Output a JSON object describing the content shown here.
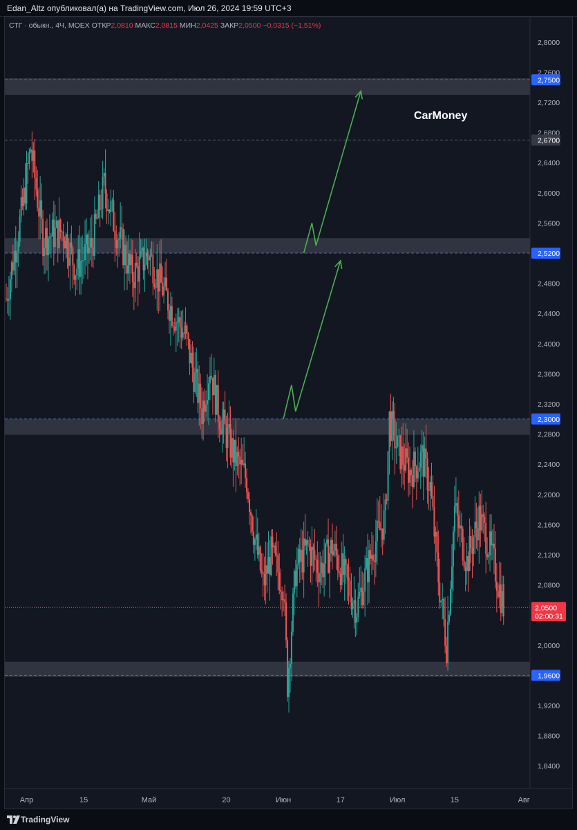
{
  "header": {
    "publisher_line": "Edan_Altz опубликовал(а) на TradingView.com, Июл 26, 2024 19:59 UTC+3"
  },
  "legend": {
    "symbol": "СТГ · обыкн., 4Ч, MOEX",
    "open_label": "ОТКР",
    "open_value": "2,0810",
    "high_label": "МАКС",
    "high_value": "2,0815",
    "low_label": "МИН",
    "low_value": "2,0425",
    "close_label": "ЗАКР",
    "close_value": "2,0500",
    "change": "−0,0315 (−1,51%)"
  },
  "brand_watermark": "CarMoney",
  "footer": {
    "logo_text": "TradingView",
    "logo_icon": "tradingview-logo-icon"
  },
  "colors": {
    "up": "#26a69a",
    "down": "#ef5350",
    "background": "#131722",
    "zone": "#3b3f4b",
    "arrow": "#4caf50",
    "axis_text": "#b2b5be",
    "level_badge": "#2962ff",
    "price_badge": "#f23645"
  },
  "chart_data": {
    "type": "candlestick",
    "title": "",
    "xlabel": "",
    "ylabel": "",
    "ylim": [
      1.82,
      2.82
    ],
    "grid": false,
    "y_ticks": [
      "2,8000",
      "2,7600",
      "2,7200",
      "2,6800",
      "2,6400",
      "2,6000",
      "2,5600",
      "2,4800",
      "2,4400",
      "2,4000",
      "2,3600",
      "2,3200",
      "2,2800",
      "2,2400",
      "2,2000",
      "2,1600",
      "2,1200",
      "2,0800",
      "2,0000",
      "1,9200",
      "1,8800",
      "1,8400"
    ],
    "x_ticks": [
      {
        "label": "Апр",
        "date": "2024-04-01"
      },
      {
        "label": "15",
        "date": "2024-04-15"
      },
      {
        "label": "Май",
        "date": "2024-05-01"
      },
      {
        "label": "20",
        "date": "2024-05-20"
      },
      {
        "label": "Июн",
        "date": "2024-06-03"
      },
      {
        "label": "17",
        "date": "2024-06-17"
      },
      {
        "label": "Июл",
        "date": "2024-07-01"
      },
      {
        "label": "15",
        "date": "2024-07-15"
      },
      {
        "label": "Авг",
        "date": "2024-08-01"
      }
    ],
    "price_levels": [
      {
        "label": "2,7500",
        "value": 2.75,
        "style": "dashed-blue"
      },
      {
        "label": "2,6700",
        "value": 2.67,
        "style": "dashed-gray"
      },
      {
        "label": "2,5200",
        "value": 2.52,
        "style": "dashed-blue"
      },
      {
        "label": "2,3000",
        "value": 2.3,
        "style": "dashed-blue"
      },
      {
        "label": "1,9600",
        "value": 1.96,
        "style": "dashed-blue"
      }
    ],
    "current_price": {
      "label": "2,0500",
      "countdown": "02:00:31",
      "value": 2.05
    },
    "zones": [
      {
        "from": 2.73,
        "to": 2.752
      },
      {
        "from": 2.52,
        "to": 2.54
      },
      {
        "from": 2.279,
        "to": 2.3
      },
      {
        "from": 1.958,
        "to": 1.978
      }
    ],
    "arrows": [
      {
        "points": [
          [
            "2024-06-03",
            2.3
          ],
          [
            "2024-06-05",
            2.345
          ],
          [
            "2024-06-06",
            2.31
          ],
          [
            "2024-06-17",
            2.51
          ]
        ]
      },
      {
        "points": [
          [
            "2024-06-08",
            2.52
          ],
          [
            "2024-06-10",
            2.56
          ],
          [
            "2024-06-11",
            2.53
          ],
          [
            "2024-06-22",
            2.735
          ]
        ]
      }
    ],
    "anchors": [
      [
        "2024-03-27",
        2.46
      ],
      [
        "2024-03-31",
        2.58
      ],
      [
        "2024-04-02",
        2.66
      ],
      [
        "2024-04-05",
        2.54
      ],
      [
        "2024-04-10",
        2.55
      ],
      [
        "2024-04-13",
        2.5
      ],
      [
        "2024-04-17",
        2.53
      ],
      [
        "2024-04-20",
        2.61
      ],
      [
        "2024-04-23",
        2.55
      ],
      [
        "2024-04-27",
        2.49
      ],
      [
        "2024-05-01",
        2.52
      ],
      [
        "2024-05-03",
        2.49
      ],
      [
        "2024-05-07",
        2.44
      ],
      [
        "2024-05-10",
        2.41
      ],
      [
        "2024-05-14",
        2.31
      ],
      [
        "2024-05-16",
        2.37
      ],
      [
        "2024-05-18",
        2.31
      ],
      [
        "2024-05-22",
        2.25
      ],
      [
        "2024-05-25",
        2.22
      ],
      [
        "2024-05-27",
        2.14
      ],
      [
        "2024-05-29",
        2.08
      ],
      [
        "2024-05-31",
        2.12
      ],
      [
        "2024-06-03",
        2.08
      ],
      [
        "2024-06-04",
        1.95
      ],
      [
        "2024-06-06",
        2.1
      ],
      [
        "2024-06-09",
        2.13
      ],
      [
        "2024-06-12",
        2.1
      ],
      [
        "2024-06-15",
        2.13
      ],
      [
        "2024-06-18",
        2.09
      ],
      [
        "2024-06-21",
        2.05
      ],
      [
        "2024-06-25",
        2.13
      ],
      [
        "2024-06-28",
        2.17
      ],
      [
        "2024-06-29",
        2.3
      ],
      [
        "2024-07-01",
        2.26
      ],
      [
        "2024-07-04",
        2.23
      ],
      [
        "2024-07-07",
        2.25
      ],
      [
        "2024-07-09",
        2.21
      ],
      [
        "2024-07-11",
        2.09
      ],
      [
        "2024-07-13",
        2.0
      ],
      [
        "2024-07-15",
        2.18
      ],
      [
        "2024-07-18",
        2.11
      ],
      [
        "2024-07-21",
        2.17
      ],
      [
        "2024-07-23",
        2.14
      ],
      [
        "2024-07-25",
        2.1
      ],
      [
        "2024-07-27",
        2.05
      ]
    ],
    "last_candle": {
      "date": "2024-07-27",
      "open": 2.081,
      "high": 2.0815,
      "low": 2.0425,
      "close": 2.05
    }
  }
}
